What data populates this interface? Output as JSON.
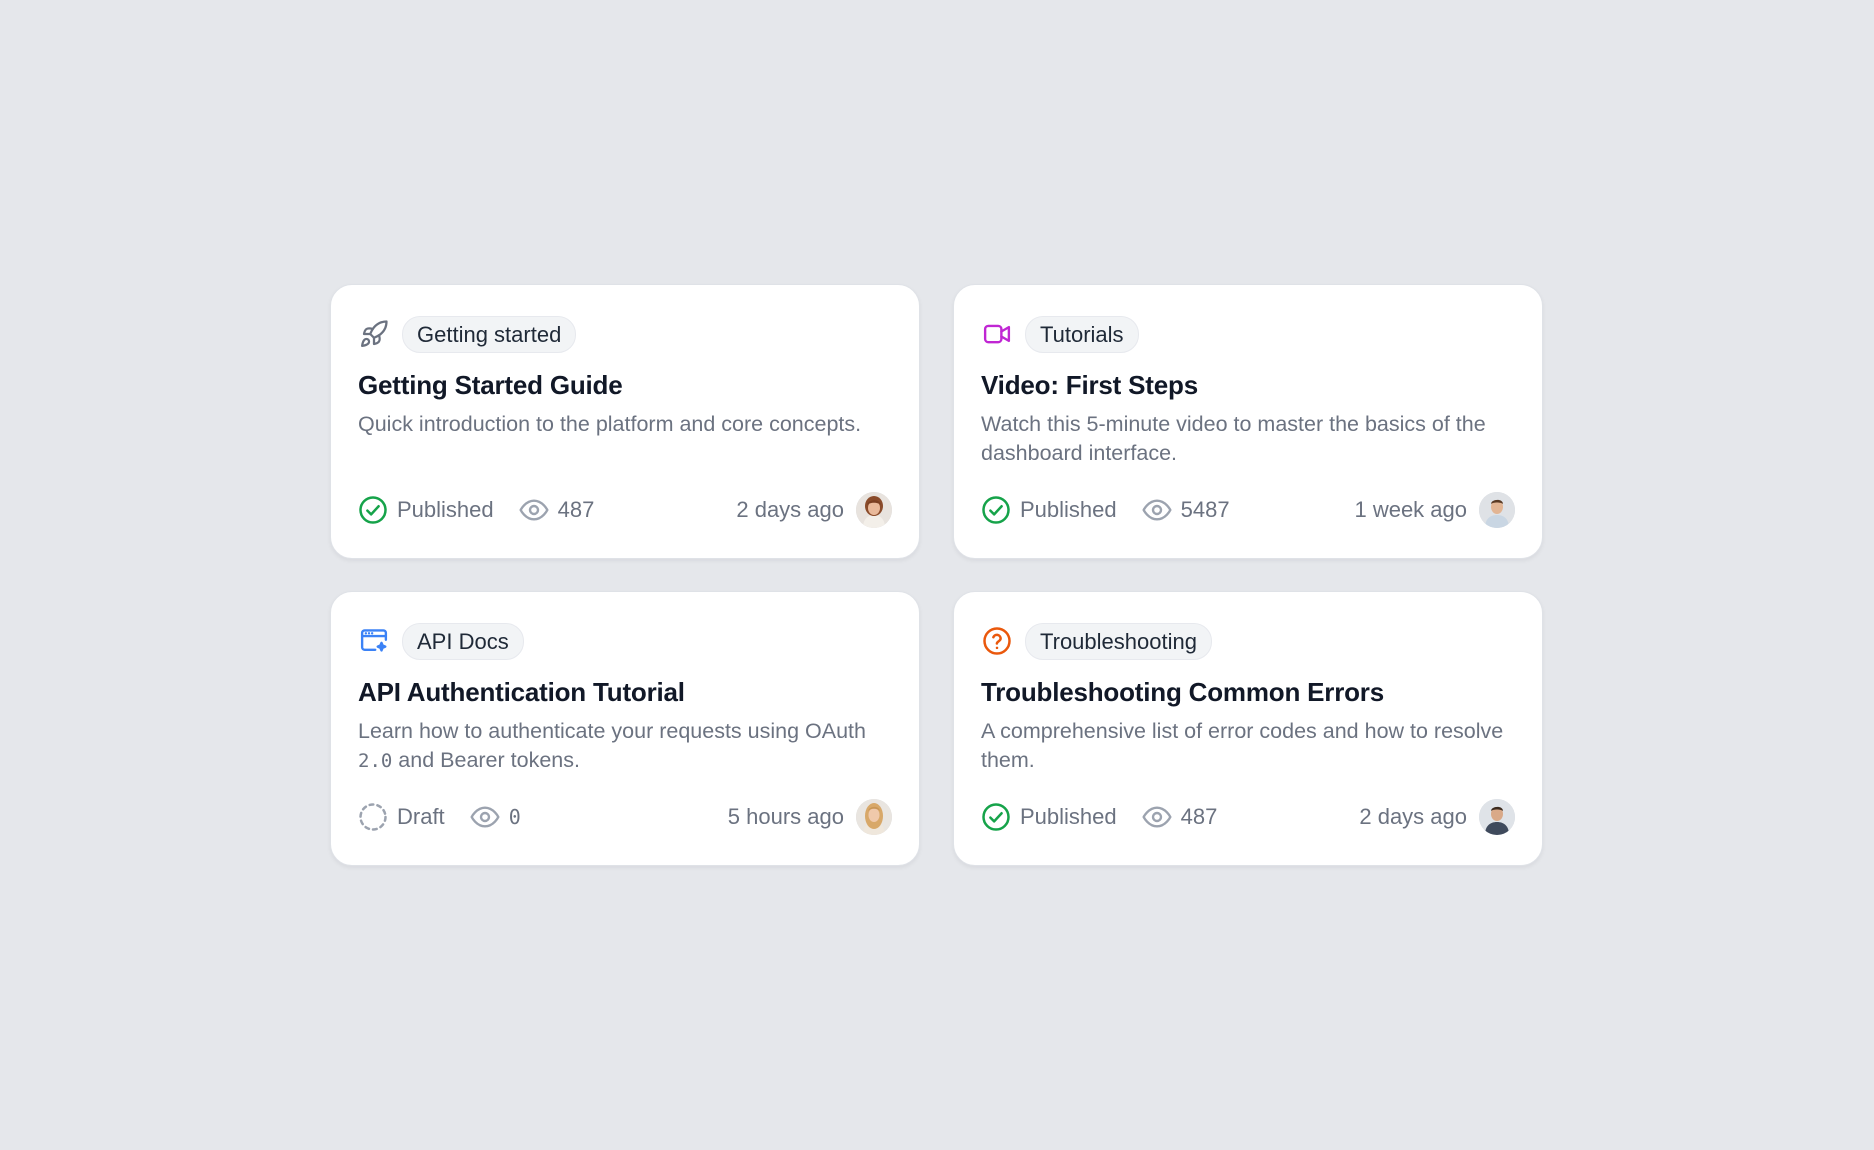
{
  "colors": {
    "background": "#e5e7eb",
    "published": "#16a34a",
    "draft": "#9ca3af",
    "getting_started_icon": "#6b7280",
    "tutorials_icon": "#c026d3",
    "api_docs_icon": "#3b82f6",
    "troubleshooting_icon": "#ea580c"
  },
  "cards": [
    {
      "icon": "rocket-icon",
      "category": "Getting started",
      "title": "Getting Started Guide",
      "description": "Quick introduction to the platform and core concepts.",
      "status": "Published",
      "views": "487",
      "time": "2 days ago",
      "avatar": "avatar-woman-brown-hair"
    },
    {
      "icon": "video-camera-icon",
      "category": "Tutorials",
      "title": "Video: First Steps",
      "description": "Watch this 5-minute video to master the basics of the dashboard interface.",
      "status": "Published",
      "views": "5487",
      "time": "1 week ago",
      "avatar": "avatar-man-light-shirt"
    },
    {
      "icon": "browser-sparkle-icon",
      "category": "API Docs",
      "title": "API Authentication Tutorial",
      "description_before_code": "Learn how to authenticate your requests using OAuth ",
      "description_code": "2.0",
      "description_after_code": " and Bearer tokens.",
      "status": "Draft",
      "views": "0",
      "time": "5 hours ago",
      "avatar": "avatar-woman-blonde-hair"
    },
    {
      "icon": "question-circle-icon",
      "category": "Troubleshooting",
      "title": "Troubleshooting Common Errors",
      "description": "A comprehensive list of error codes and how to resolve them.",
      "status": "Published",
      "views": "487",
      "time": "2 days ago",
      "avatar": "avatar-man-dark-shirt"
    }
  ]
}
